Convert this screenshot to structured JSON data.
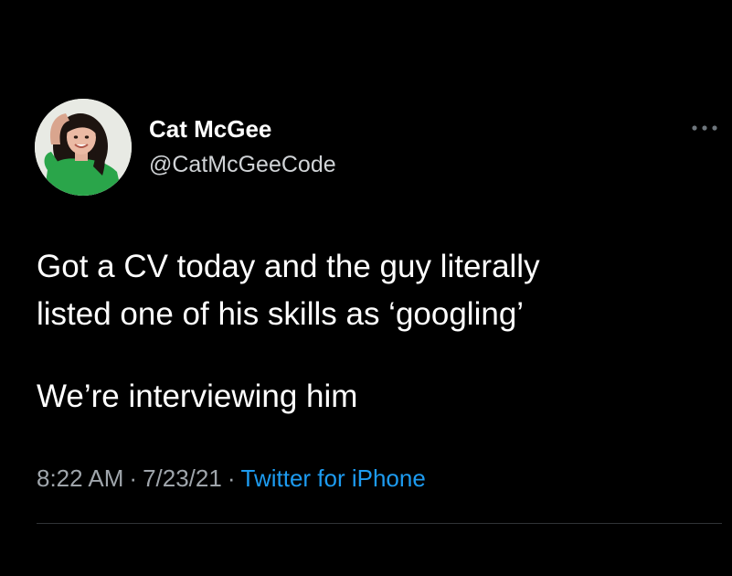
{
  "tweet": {
    "display_name": "Cat McGee",
    "handle": "@CatMcGeeCode",
    "more_icon": "more-horizontal-icon",
    "text_lines": [
      "Got a CV today and the guy literally",
      "listed one of his skills as ‘googling’",
      "We’re interviewing him"
    ],
    "time": "8:22 AM",
    "date": "7/23/21",
    "source": "Twitter for iPhone",
    "separator": "·"
  },
  "colors": {
    "background": "#000000",
    "text": "#ffffff",
    "secondary_text": "#9fa5ab",
    "link": "#1d9bf0",
    "divider": "#2f3336"
  }
}
